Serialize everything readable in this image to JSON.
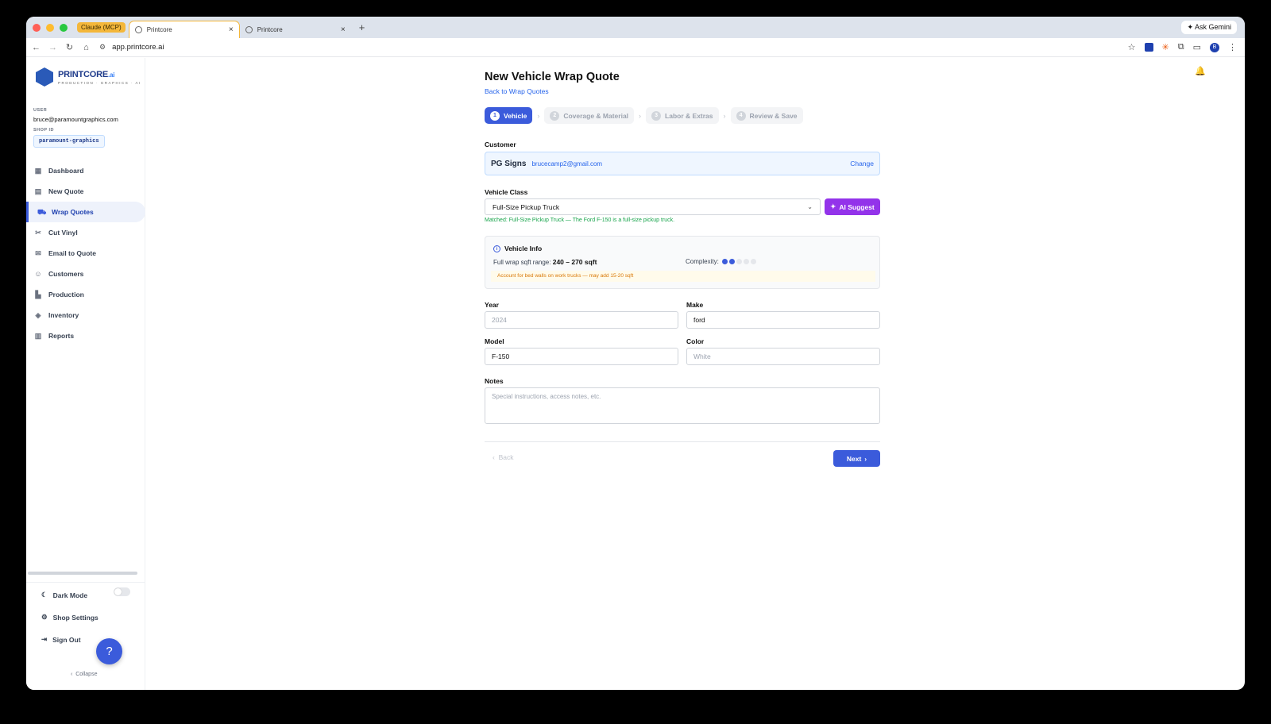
{
  "browser": {
    "tab_group_label": "Claude (MCP)",
    "tabs": [
      {
        "title": "Printcore"
      },
      {
        "title": "Printcore"
      }
    ],
    "url": "app.printcore.ai",
    "ask_gemini": "Ask Gemini",
    "profile_initial": "B"
  },
  "sidebar": {
    "logo_main": "PRINTCORE",
    "logo_suffix": ".ai",
    "logo_tagline": "PRODUCTION · GRAPHICS · AI",
    "user_label": "USER",
    "user_email": "bruce@paramountgraphics.com",
    "shop_label": "SHOP ID",
    "shop_id": "paramount-graphics",
    "items": [
      {
        "label": "Dashboard",
        "icon": "dashboard-icon"
      },
      {
        "label": "New Quote",
        "icon": "document-icon"
      },
      {
        "label": "Wrap Quotes",
        "icon": "car-icon"
      },
      {
        "label": "Cut Vinyl",
        "icon": "scissors-icon"
      },
      {
        "label": "Email to Quote",
        "icon": "mail-icon"
      },
      {
        "label": "Customers",
        "icon": "users-icon"
      },
      {
        "label": "Production",
        "icon": "factory-icon"
      },
      {
        "label": "Inventory",
        "icon": "box-icon"
      },
      {
        "label": "Reports",
        "icon": "bar-chart-icon"
      }
    ],
    "active_item": "Wrap Quotes",
    "dark_mode": "Dark Mode",
    "shop_settings": "Shop Settings",
    "sign_out": "Sign Out",
    "collapse": "Collapse"
  },
  "main": {
    "title": "New Vehicle Wrap Quote",
    "back_link": "Back to Wrap Quotes",
    "steps": [
      {
        "num": "1",
        "label": "Vehicle"
      },
      {
        "num": "2",
        "label": "Coverage & Material"
      },
      {
        "num": "3",
        "label": "Labor & Extras"
      },
      {
        "num": "4",
        "label": "Review & Save"
      }
    ],
    "customer_label": "Customer",
    "customer_name": "PG Signs",
    "customer_email": "brucecamp2@gmail.com",
    "customer_change": "Change",
    "vehicle_class_label": "Vehicle Class",
    "vehicle_class_value": "Full-Size Pickup Truck",
    "ai_suggest": "AI Suggest",
    "match_text": "Matched: Full-Size Pickup Truck — The Ford F-150 is a full-size pickup truck.",
    "vehicle_info": {
      "title": "Vehicle Info",
      "range_label": "Full wrap sqft range:",
      "range_value": "240 – 270 sqft",
      "complexity_label": "Complexity:",
      "complexity_level": 2,
      "complexity_max": 5,
      "warning": "Account for bed walls on work trucks — may add 15-20 sqft"
    },
    "year_label": "Year",
    "year_placeholder": "2024",
    "make_label": "Make",
    "make_value": "ford",
    "model_label": "Model",
    "model_value": "F-150",
    "color_label": "Color",
    "color_placeholder": "White",
    "notes_label": "Notes",
    "notes_placeholder": "Special instructions, access notes, etc.",
    "back_button": "Back",
    "next_button": "Next"
  },
  "colors": {
    "accent": "#3b5bdb",
    "ai": "#9333ea",
    "success": "#16a34a",
    "warning": "#d97706"
  }
}
